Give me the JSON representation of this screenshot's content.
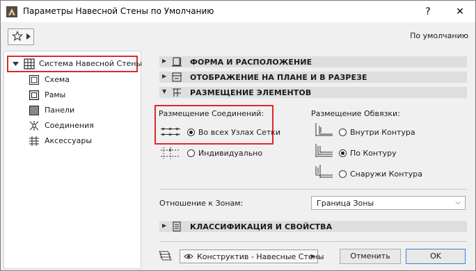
{
  "window": {
    "title": "Параметры Навесной Стены по Умолчанию",
    "help_glyph": "?",
    "close_glyph": "✕"
  },
  "toolbar": {
    "favorites_icon": "star-icon",
    "defaults_label": "По умолчанию"
  },
  "tree": {
    "root_label": "Система Навесной Стены",
    "items": [
      {
        "label": "Схема",
        "icon": "scheme-icon"
      },
      {
        "label": "Рамы",
        "icon": "frames-icon"
      },
      {
        "label": "Панели",
        "icon": "panels-icon"
      },
      {
        "label": "Соединения",
        "icon": "junctions-icon"
      },
      {
        "label": "Аксессуары",
        "icon": "accessories-icon"
      }
    ]
  },
  "sections": {
    "shape": "ФОРМА И РАСПОЛОЖЕНИЕ",
    "plan": "ОТОБРАЖЕНИЕ НА ПЛАНЕ И В РАЗРЕЗЕ",
    "placement": "РАЗМЕЩЕНИЕ ЭЛЕМЕНТОВ",
    "classification": "КЛАССИФИКАЦИЯ И СВОЙСТВА"
  },
  "junction_placement": {
    "heading": "Размещение Соединений:",
    "options": [
      {
        "label": "Во всех Узлах Сетки",
        "selected": true
      },
      {
        "label": "Индивидуально",
        "selected": false
      }
    ]
  },
  "boundary_placement": {
    "heading": "Размещение Обвязки:",
    "options": [
      {
        "label": "Внутри Контура",
        "selected": false
      },
      {
        "label": "По Контуру",
        "selected": true
      },
      {
        "label": "Снаружи Контура",
        "selected": false
      }
    ]
  },
  "zones": {
    "label": "Отношение к Зонам:",
    "value": "Граница Зоны"
  },
  "footer": {
    "layer_label": "Конструктив - Навесные Стены",
    "cancel_label": "Отменить",
    "ok_label": "OK"
  },
  "colors": {
    "highlight": "#e0262b",
    "section_bg": "#dedede",
    "ok_border": "#3b7fd6"
  }
}
